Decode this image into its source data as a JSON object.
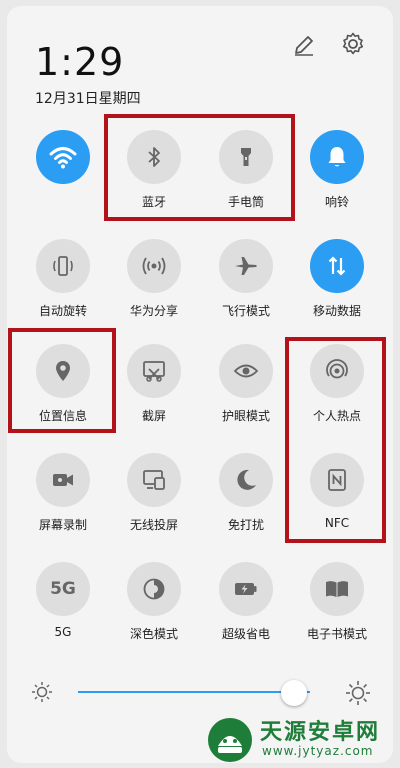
{
  "status": {
    "time": "1:29",
    "date": "12月31日星期四"
  },
  "icons": {
    "edit": "pencil-icon",
    "settings": "gear-icon"
  },
  "tiles": [
    {
      "label": "",
      "icon": "wifi-icon",
      "on": true
    },
    {
      "label": "蓝牙",
      "icon": "bluetooth-icon",
      "on": false
    },
    {
      "label": "手电筒",
      "icon": "flashlight-icon",
      "on": false
    },
    {
      "label": "响铃",
      "icon": "bell-icon",
      "on": true
    },
    {
      "label": "自动旋转",
      "icon": "auto-rotate-icon",
      "on": false
    },
    {
      "label": "华为分享",
      "icon": "share-icon",
      "on": false
    },
    {
      "label": "飞行模式",
      "icon": "airplane-icon",
      "on": false
    },
    {
      "label": "移动数据",
      "icon": "mobile-data-icon",
      "on": true
    },
    {
      "label": "位置信息",
      "icon": "location-icon",
      "on": false
    },
    {
      "label": "截屏",
      "icon": "screenshot-icon",
      "on": false
    },
    {
      "label": "护眼模式",
      "icon": "eye-icon",
      "on": false
    },
    {
      "label": "个人热点",
      "icon": "hotspot-icon",
      "on": false
    },
    {
      "label": "屏幕录制",
      "icon": "screen-record-icon",
      "on": false
    },
    {
      "label": "无线投屏",
      "icon": "wireless-projection-icon",
      "on": false
    },
    {
      "label": "免打扰",
      "icon": "moon-icon",
      "on": false
    },
    {
      "label": "NFC",
      "icon": "nfc-icon",
      "on": false
    },
    {
      "label": "5G",
      "icon": "5g-icon",
      "on": false,
      "glyph": "5G"
    },
    {
      "label": "深色模式",
      "icon": "dark-mode-icon",
      "on": false
    },
    {
      "label": "超级省电",
      "icon": "battery-saver-icon",
      "on": false
    },
    {
      "label": "电子书模式",
      "icon": "ebook-icon",
      "on": false
    }
  ],
  "brightness": {
    "level": 0.93
  },
  "watermark": {
    "title": "天源安卓网",
    "url": "www.jytyaz.com"
  },
  "colors": {
    "accent": "#2b9df3",
    "highlight": "#b3121b",
    "tile_off": "#dedede"
  }
}
